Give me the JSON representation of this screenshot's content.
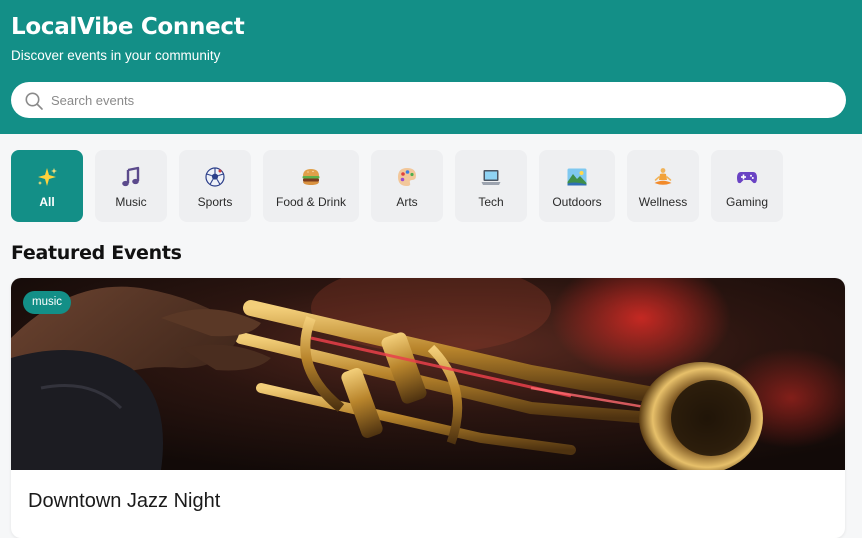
{
  "header": {
    "title": "LocalVibe Connect",
    "subtitle": "Discover events in your community",
    "bg_color": "#138f87"
  },
  "search": {
    "placeholder": "Search events",
    "value": ""
  },
  "categories": [
    {
      "label": "All",
      "icon": "sparkles-icon",
      "glyph": "✨",
      "active": true
    },
    {
      "label": "Music",
      "icon": "music-note-icon",
      "glyph": "🎵",
      "active": false
    },
    {
      "label": "Sports",
      "icon": "soccer-ball-icon",
      "glyph": "⚽",
      "active": false
    },
    {
      "label": "Food & Drink",
      "icon": "burger-icon",
      "glyph": "🍔",
      "active": false
    },
    {
      "label": "Arts",
      "icon": "palette-icon",
      "glyph": "🎨",
      "active": false
    },
    {
      "label": "Tech",
      "icon": "laptop-icon",
      "glyph": "💻",
      "active": false
    },
    {
      "label": "Outdoors",
      "icon": "landscape-icon",
      "glyph": "🏞",
      "active": false
    },
    {
      "label": "Wellness",
      "icon": "meditation-icon",
      "glyph": "🧘",
      "active": false
    },
    {
      "label": "Gaming",
      "icon": "game-controller-icon",
      "glyph": "🎮",
      "active": false
    }
  ],
  "featured": {
    "section_title": "Featured Events",
    "events": [
      {
        "badge": "music",
        "title": "Downtown Jazz Night",
        "image": "trumpet-photo"
      }
    ]
  }
}
